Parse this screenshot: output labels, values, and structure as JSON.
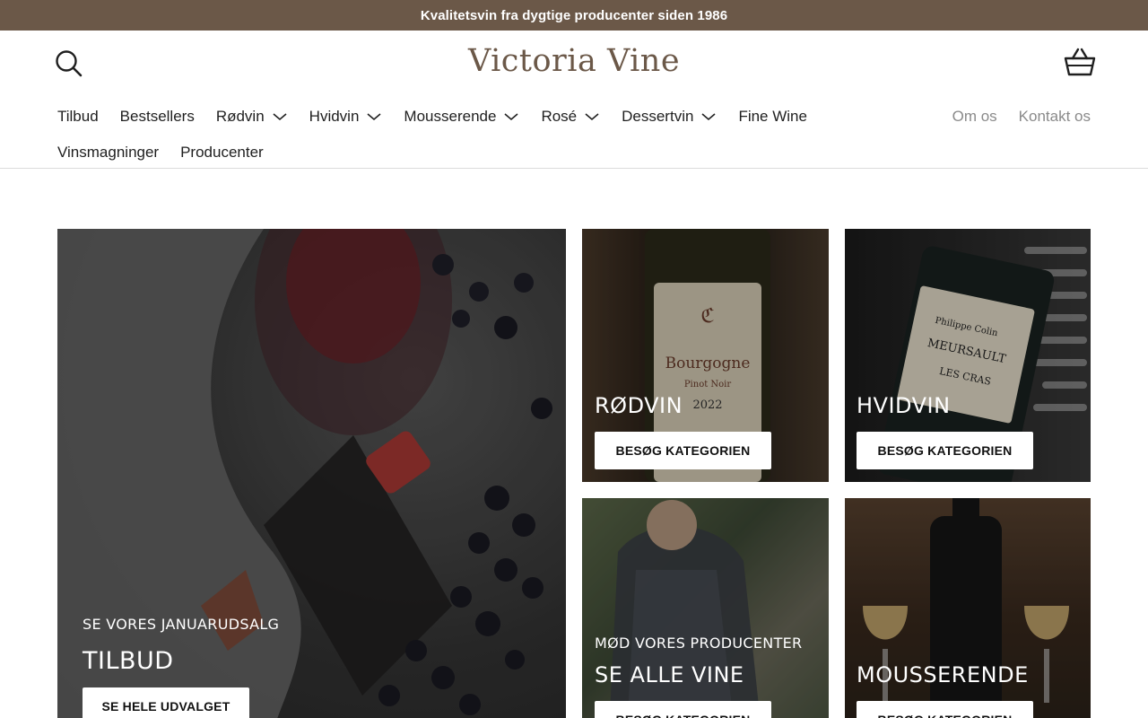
{
  "announcement": {
    "text": "Kvalitetsvin fra dygtige producenter siden 1986"
  },
  "header": {
    "logo": "Victoria Vine",
    "search_icon": "search-icon",
    "cart_icon": "basket-icon"
  },
  "nav": {
    "row1": [
      {
        "label": "Tilbud",
        "dropdown": false
      },
      {
        "label": "Bestsellers",
        "dropdown": false
      },
      {
        "label": "Rødvin",
        "dropdown": true
      },
      {
        "label": "Hvidvin",
        "dropdown": true
      },
      {
        "label": "Mousserende",
        "dropdown": true
      },
      {
        "label": "Rosé",
        "dropdown": true
      },
      {
        "label": "Dessertvin",
        "dropdown": true
      },
      {
        "label": "Fine Wine",
        "dropdown": false
      }
    ],
    "row2": [
      {
        "label": "Vinsmagninger",
        "dropdown": false
      },
      {
        "label": "Producenter",
        "dropdown": false
      }
    ],
    "right": [
      {
        "label": "Om os"
      },
      {
        "label": "Kontakt os"
      }
    ]
  },
  "tiles": {
    "tilbud": {
      "sub": "SE VORES JANUARUDSALG",
      "title": "TILBUD",
      "button": "SE HELE UDVALGET"
    },
    "rodvin": {
      "title": "RØDVIN",
      "button": "BESØG KATEGORIEN"
    },
    "hvidvin": {
      "title": "HVIDVIN",
      "button": "BESØG KATEGORIEN"
    },
    "producenter": {
      "sub": "MØD VORES PRODUCENTER",
      "title": "SE ALLE VINE",
      "button": "BESØG KATEGORIEN"
    },
    "mousserende": {
      "title": "MOUSSERENDE",
      "button": "BESØG KATEGORIEN"
    }
  },
  "colors": {
    "brand": "#6b5848",
    "nav_muted": "#8a8a8a"
  }
}
